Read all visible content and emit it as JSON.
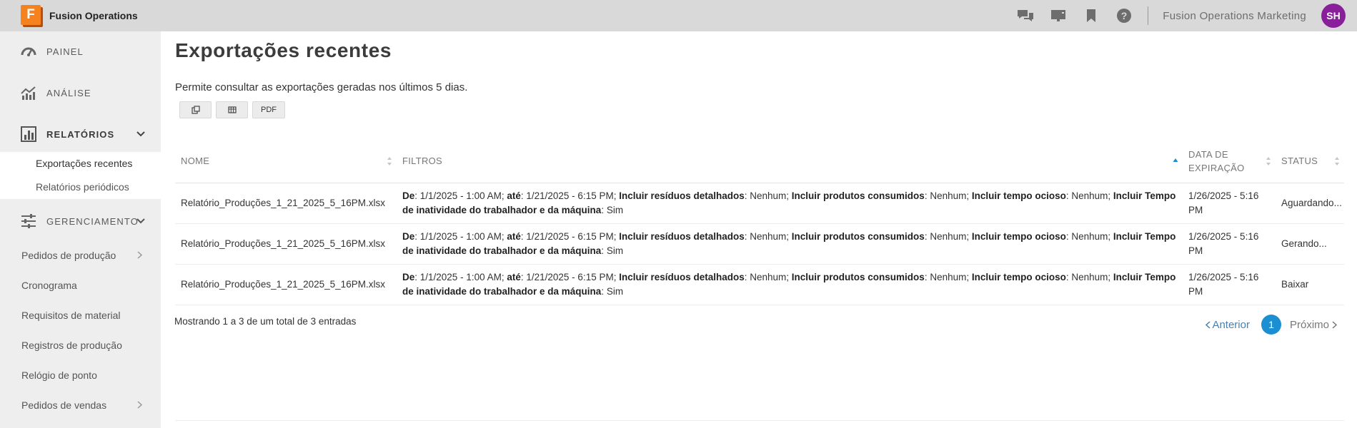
{
  "app": {
    "title": "Fusion Operations",
    "logo_letter": "F"
  },
  "topbar": {
    "icons": [
      "chat-icon",
      "presentation-icon",
      "bookmark-icon",
      "help-icon"
    ],
    "org_name": "Fusion Operations Marketing",
    "avatar_initials": "SH",
    "avatar_color": "#8a1f9c"
  },
  "sidebar": {
    "main": [
      {
        "label": "PAINEL",
        "icon": "dashboard-icon"
      },
      {
        "label": "ANÁLISE",
        "icon": "analytics-icon"
      },
      {
        "label": "RELATÓRIOS",
        "icon": "reports-icon"
      },
      {
        "label": "GERENCIAMENTO",
        "icon": "sliders-icon"
      }
    ],
    "reports_sub": [
      "Exportações recentes",
      "Relatórios periódicos"
    ],
    "management_sub": [
      "Pedidos de produção",
      "Cronograma",
      "Requisitos de material",
      "Registros de produção",
      "Relógio de ponto",
      "Pedidos de vendas"
    ]
  },
  "page": {
    "title": "Exportações recentes",
    "description": "Permite consultar as exportações geradas nos últimos 5 dias.",
    "buttons": {
      "copy_icon": "copy-icon",
      "csv_icon": "table-icon",
      "pdf": "PDF"
    }
  },
  "table": {
    "headers": {
      "name": "NOME",
      "filters": "FILTROS",
      "expiry_line1": "DATA DE",
      "expiry_line2": "EXPIRAÇÃO",
      "status": "STATUS"
    },
    "filter_parts": {
      "de": "De",
      "de_val": ": 1/1/2025 - 1:00 AM; ",
      "ate": "até",
      "ate_val": ": 1/21/2025 - 6:15 PM; ",
      "waste": "Incluir resíduos detalhados",
      "waste_val": ": Nenhum; ",
      "consumed": "Incluir produtos consumidos",
      "consumed_val": ": Nenhum; ",
      "idle": "Incluir tempo ocioso",
      "idle_val": ": Nenhum; ",
      "idle_worker": "Incluir Tempo de inatividade do trabalhador e da máquina",
      "idle_worker_val": ": Sim"
    },
    "rows": [
      {
        "name": "Relatório_Produções_1_21_2025_5_16PM.xlsx",
        "expiry": "1/26/2025 - 5:16 PM",
        "status": "Aguardando..."
      },
      {
        "name": "Relatório_Produções_1_21_2025_5_16PM.xlsx",
        "expiry": "1/26/2025 - 5:16 PM",
        "status": "Gerando..."
      },
      {
        "name": "Relatório_Produções_1_21_2025_5_16PM.xlsx",
        "expiry": "1/26/2025 - 5:16 PM",
        "status": "Baixar"
      }
    ]
  },
  "footer": {
    "info": "Mostrando 1 a 3 de um total de 3 entradas",
    "prev": "Anterior",
    "page": "1",
    "next": "Próximo"
  },
  "colors": {
    "accent": "#1b8fd1",
    "logo_orange": "#f5821f"
  }
}
